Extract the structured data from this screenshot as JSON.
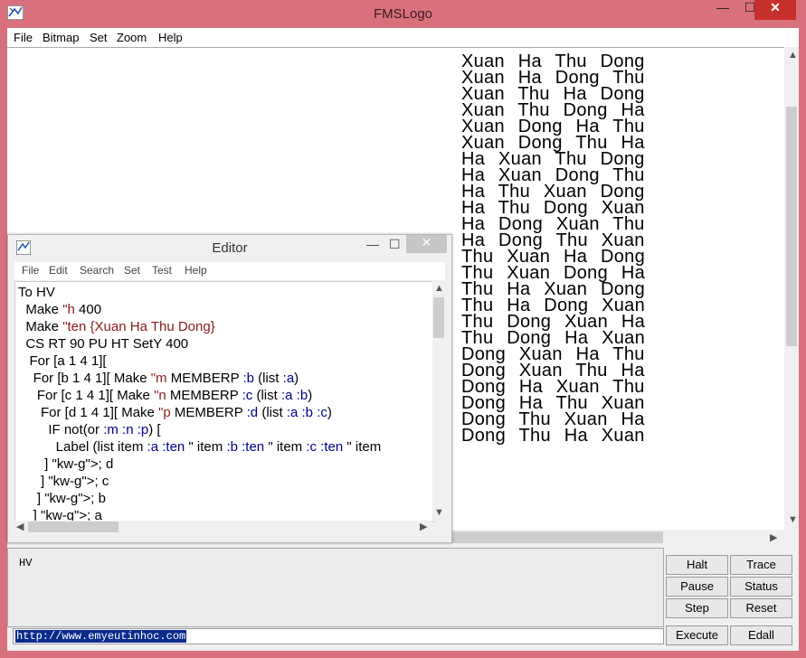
{
  "window": {
    "title": "FMSLogo",
    "min": "—",
    "max": "☐",
    "close": "✕"
  },
  "menubar": [
    "File",
    "Bitmap",
    "Set",
    "Zoom",
    "Help"
  ],
  "canvas_lines": [
    "Xuan Ha Thu Dong",
    "Xuan Ha Dong Thu",
    "Xuan Thu Ha Dong",
    "Xuan Thu Dong Ha",
    "Xuan Dong Ha Thu",
    "Xuan Dong Thu Ha",
    "Ha Xuan Thu Dong",
    "Ha Xuan Dong Thu",
    "Ha Thu Xuan Dong",
    "Ha Thu Dong Xuan",
    "Ha Dong Xuan Thu",
    "Ha Dong Thu Xuan",
    "Thu Xuan Ha Dong",
    "Thu Xuan Dong Ha",
    "Thu Ha Xuan Dong",
    "Thu Ha Dong Xuan",
    "Thu Dong Xuan Ha",
    "Thu Dong Ha Xuan",
    "Dong Xuan Ha Thu",
    "Dong Xuan Thu Ha",
    "Dong Ha Xuan Thu",
    "Dong Ha Thu Xuan",
    "Dong Thu Xuan Ha",
    "Dong Thu Ha Xuan"
  ],
  "editor": {
    "title": "Editor",
    "menu": [
      "File",
      "Edit",
      "Search",
      "Set",
      "Test",
      "Help"
    ],
    "code_lines": [
      "To HV",
      "  Make \"h 400",
      "  Make \"ten {Xuan Ha Thu Dong}",
      "  CS RT 90 PU HT SetY 400",
      "   For [a 1 4 1][",
      "    For [b 1 4 1][ Make \"m MEMBERP :b (list :a)",
      "     For [c 1 4 1][ Make \"n MEMBERP :c (list :a :b)",
      "      For [d 1 4 1][ Make \"p MEMBERP :d (list :a :b :c)",
      "        IF not(or :m :n :p) [",
      "          Label (list item :a :ten \" item :b :ten \" item :c :ten \" item",
      "       ] ; d",
      "      ] ; c",
      "     ] ; b",
      "    ] ; a"
    ]
  },
  "history": "HV",
  "command_input": "http://www.emyeutinhoc.com",
  "buttons": {
    "halt": "Halt",
    "trace": "Trace",
    "pause": "Pause",
    "status": "Status",
    "step": "Step",
    "reset": "Reset",
    "execute": "Execute",
    "edall": "Edall"
  }
}
